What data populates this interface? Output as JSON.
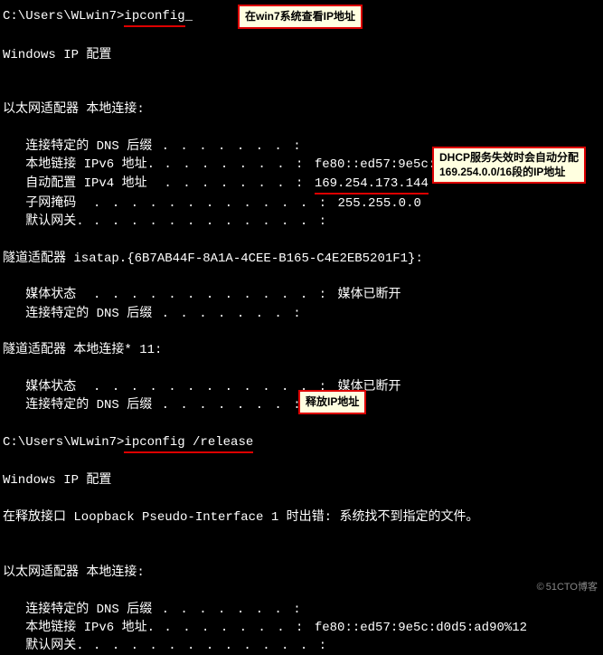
{
  "cmd1": {
    "path": "C:\\Users\\WLwin7>",
    "command": "ipconfig",
    "tail": "_"
  },
  "header1": "Windows IP 配置",
  "adapter1": {
    "title": "以太网适配器 本地连接:",
    "dns_label": "   连接特定的 DNS 后缀",
    "dns_dots": " . . . . . . . :",
    "ipv6_label": "   本地链接 IPv6 地址.",
    "ipv6_dots": " . . . . . . . : ",
    "ipv6_value": "fe80::ed57:9e5c:d0d5:ad90%12",
    "ipv4_label": "   自动配置 IPv4 地址 ",
    "ipv4_dots": " . . . . . . . : ",
    "ipv4_value": "169.254.173.144",
    "mask_label": "   子网掩码 ",
    "mask_dots": " . . . . . . . . . . . . : ",
    "mask_value": "255.255.0.0",
    "gw_label": "   默认网关.",
    "gw_dots": " . . . . . . . . . . . . :"
  },
  "adapter2": {
    "title": "隧道适配器 isatap.{6B7AB44F-8A1A-4CEE-B165-C4E2EB5201F1}:",
    "media_label": "   媒体状态 ",
    "media_dots": " . . . . . . . . . . . . : ",
    "media_value": "媒体已断开",
    "dns_label": "   连接特定的 DNS 后缀",
    "dns_dots": " . . . . . . . :"
  },
  "adapter3": {
    "title": "隧道适配器 本地连接* 11:",
    "media_label": "   媒体状态 ",
    "media_dots": " . . . . . . . . . . . . : ",
    "media_value": "媒体已断开",
    "dns_label": "   连接特定的 DNS 后缀",
    "dns_dots": " . . . . . . . :"
  },
  "cmd2": {
    "path": "C:\\Users\\WLwin7>",
    "command": "ipconfig /release"
  },
  "header2": "Windows IP 配置",
  "error_line": "在释放接口 Loopback Pseudo-Interface 1 时出错: 系统找不到指定的文件。",
  "adapter4": {
    "title": "以太网适配器 本地连接:",
    "dns_label": "   连接特定的 DNS 后缀",
    "dns_dots": " . . . . . . . :",
    "ipv6_label": "   本地链接 IPv6 地址.",
    "ipv6_dots": " . . . . . . . : ",
    "ipv6_value": "fe80::ed57:9e5c:d0d5:ad90%12",
    "gw_label": "   默认网关.",
    "gw_dots": " . . . . . . . . . . . . :"
  },
  "annotations": {
    "a1": "在win7系统查看IP地址",
    "a2_line1": "DHCP服务失效时会自动分配",
    "a2_line2": "169.254.0.0/16段的IP地址",
    "a3": "释放IP地址"
  },
  "watermark": "51CTO博客"
}
